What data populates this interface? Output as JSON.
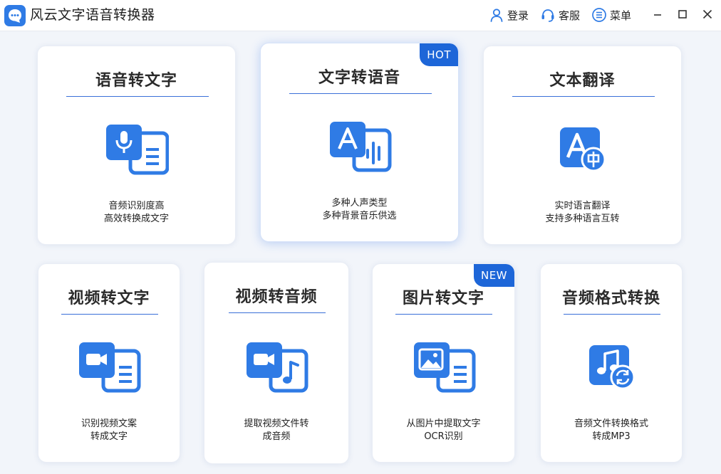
{
  "window": {
    "title": "风云文字语音转换器"
  },
  "titlebar": {
    "login_label": "登录",
    "service_label": "客服",
    "menu_label": "菜单"
  },
  "colors": {
    "accent": "#2f7be5",
    "badge": "#1d66d8",
    "divider": "#3a6fd8"
  },
  "cards": [
    {
      "title": "语音转文字",
      "desc1": "音频识别度高",
      "desc2": "高效转换成文字",
      "icon": "mic-document-icon"
    },
    {
      "title": "文字转语音",
      "desc1": "多种人声类型",
      "desc2": "多种背景音乐供选",
      "icon": "text-to-speech-icon",
      "badge": "HOT"
    },
    {
      "title": "文本翻译",
      "desc1": "实时语言翻译",
      "desc2": "支持多种语言互转",
      "icon": "translate-icon"
    },
    {
      "title": "视频转文字",
      "desc1": "识别视频文案",
      "desc2": "转成文字",
      "icon": "video-document-icon"
    },
    {
      "title": "视频转音频",
      "desc1": "提取视频文件转",
      "desc2": "成音频",
      "icon": "video-music-icon"
    },
    {
      "title": "图片转文字",
      "desc1": "从图片中提取文字",
      "desc2": "OCR识别",
      "icon": "image-document-icon",
      "badge": "NEW"
    },
    {
      "title": "音频格式转换",
      "desc1": "音频文件转换格式",
      "desc2": "转成MP3",
      "icon": "music-convert-icon"
    }
  ]
}
